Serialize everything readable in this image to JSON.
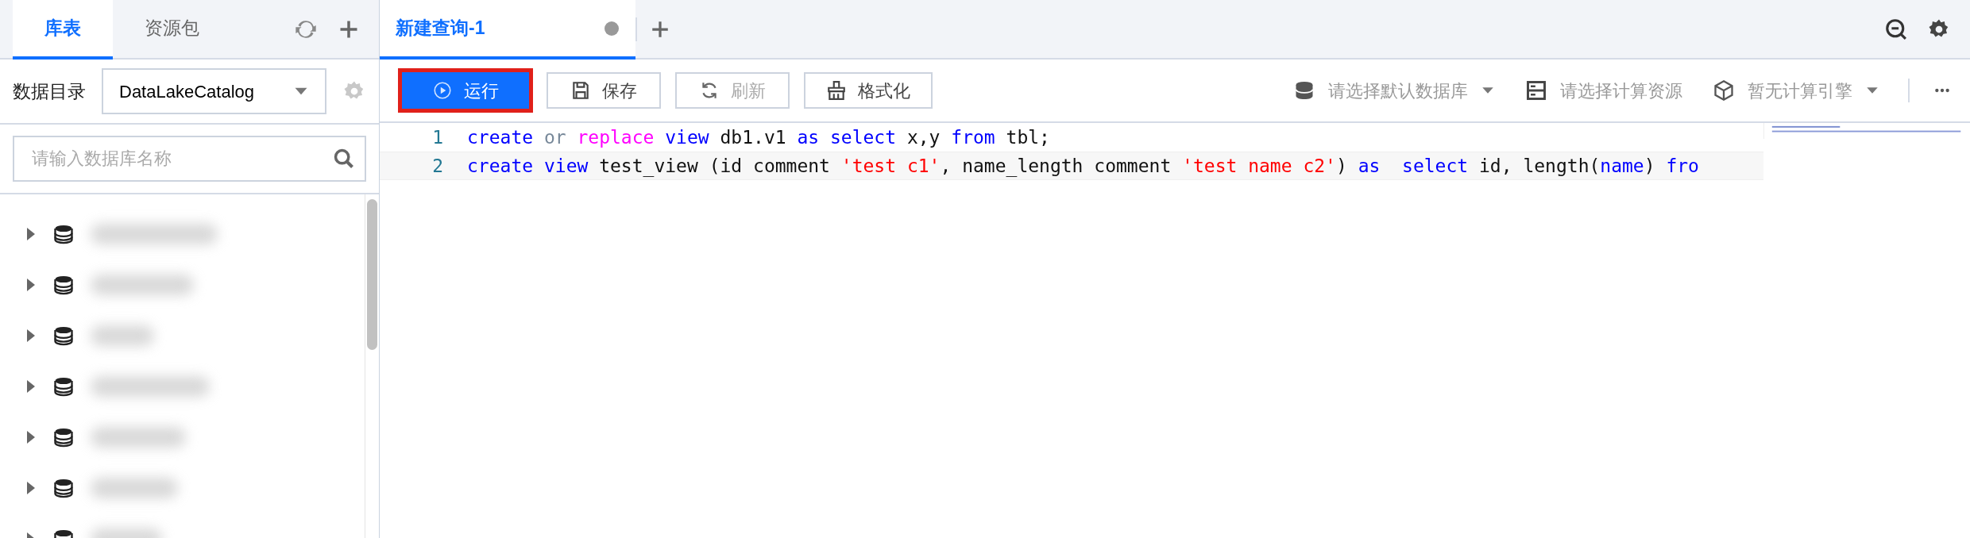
{
  "sidebar": {
    "tabs": [
      {
        "label": "库表",
        "selected": true
      },
      {
        "label": "资源包",
        "selected": false
      }
    ],
    "catalog_label": "数据目录",
    "catalog_select": {
      "value": "DataLakeCatalog"
    },
    "search": {
      "placeholder": "请输入数据库名称"
    },
    "tree": [
      {
        "expanded": false
      },
      {
        "expanded": false
      },
      {
        "expanded": false
      },
      {
        "expanded": false
      },
      {
        "expanded": false
      },
      {
        "expanded": false
      },
      {
        "expanded": false
      }
    ]
  },
  "editor_tabs": [
    {
      "label": "新建查询-1",
      "selected": true,
      "unsaved": true
    }
  ],
  "toolbar": {
    "buttons": [
      {
        "label": "运行",
        "kind": "run",
        "highlighted": true,
        "disabled": false
      },
      {
        "label": "保存",
        "kind": "save",
        "highlighted": false,
        "disabled": false
      },
      {
        "label": "刷新",
        "kind": "refresh",
        "highlighted": false,
        "disabled": true
      },
      {
        "label": "格式化",
        "kind": "format",
        "highlighted": false,
        "disabled": false
      }
    ],
    "selectors": [
      {
        "label": "请选择默认数据库",
        "kind": "database",
        "dropdown": true
      },
      {
        "label": "请选择计算资源",
        "kind": "server",
        "dropdown": false
      },
      {
        "label": "暂无计算引擎",
        "kind": "engine",
        "dropdown": true
      }
    ]
  },
  "code_lines": [
    {
      "number": "1",
      "current": false,
      "tokens": [
        {
          "kind": "keyword",
          "text": "create "
        },
        {
          "kind": "operator",
          "text": "or "
        },
        {
          "kind": "function",
          "text": "replace "
        },
        {
          "kind": "keyword",
          "text": "view"
        },
        {
          "kind": "plain",
          "text": " db1.v1 "
        },
        {
          "kind": "keyword",
          "text": "as "
        },
        {
          "kind": "keyword",
          "text": "select"
        },
        {
          "kind": "plain",
          "text": " x,y "
        },
        {
          "kind": "keyword",
          "text": "from"
        },
        {
          "kind": "plain",
          "text": " tbl;"
        }
      ]
    },
    {
      "number": "2",
      "current": true,
      "tokens": [
        {
          "kind": "keyword",
          "text": "create "
        },
        {
          "kind": "keyword",
          "text": "view"
        },
        {
          "kind": "plain",
          "text": " test_view (id comment "
        },
        {
          "kind": "string",
          "text": "'test c1'"
        },
        {
          "kind": "plain",
          "text": ", name_length comment "
        },
        {
          "kind": "string",
          "text": "'test name c2'"
        },
        {
          "kind": "plain",
          "text": ") "
        },
        {
          "kind": "keyword",
          "text": "as  "
        },
        {
          "kind": "keyword",
          "text": "select"
        },
        {
          "kind": "plain",
          "text": " id, length("
        },
        {
          "kind": "keyword",
          "text": "name"
        },
        {
          "kind": "plain",
          "text": ") "
        },
        {
          "kind": "keyword",
          "text": "fro"
        }
      ]
    }
  ]
}
